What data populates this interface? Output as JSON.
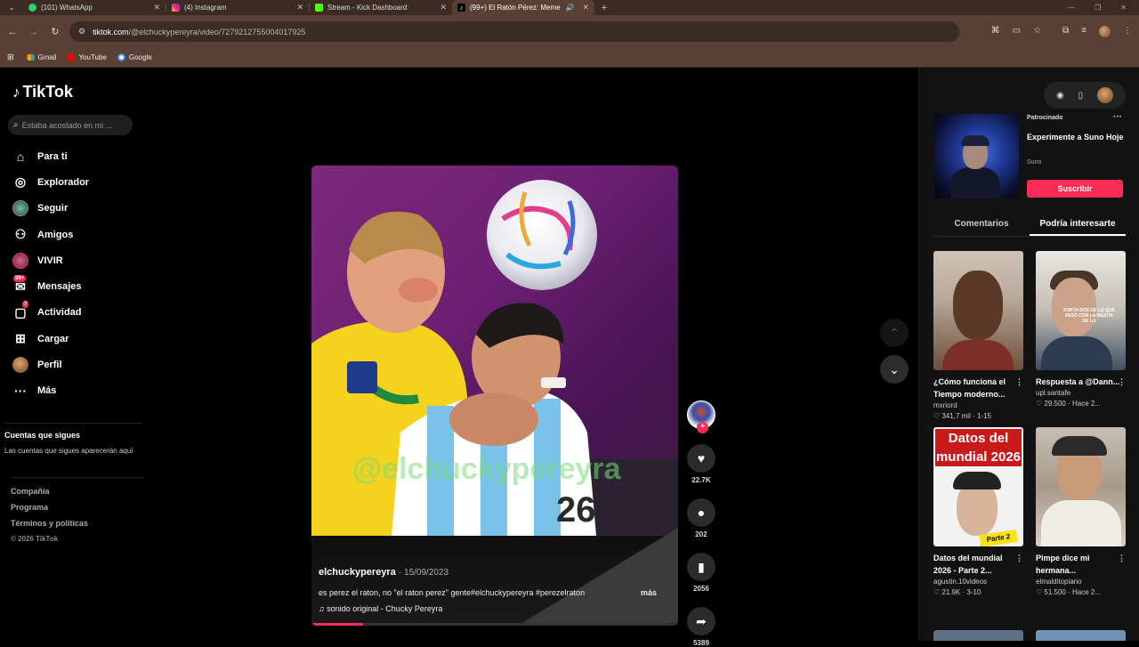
{
  "browser": {
    "tabs": [
      {
        "title": "(101) WhatsApp",
        "color": "#25d366"
      },
      {
        "title": "(4) Instagram",
        "color": "#e1306c"
      },
      {
        "title": "Stream - Kick Dashboard",
        "color": "#53fc18"
      },
      {
        "title": "(99+) El Ratón Pérez: Meme",
        "color": "#000000",
        "active": true
      }
    ],
    "url_host": "tiktok.com",
    "url_path": "/@elchuckypereyra/video/7279212755004017925",
    "bookmarks": [
      "Gmail",
      "YouTube",
      "Google"
    ]
  },
  "tiktok": {
    "logo": "TikTok",
    "search_placeholder": "Estaba acostado en mi ...",
    "nav": [
      {
        "label": "Para ti",
        "icon": "home-icon"
      },
      {
        "label": "Explorador",
        "icon": "compass-icon"
      },
      {
        "label": "Seguir",
        "icon": "following-icon"
      },
      {
        "label": "Amigos",
        "icon": "friends-icon"
      },
      {
        "label": "VIVIR",
        "icon": "live-icon"
      },
      {
        "label": "Mensajes",
        "icon": "messages-icon",
        "badge": "99+"
      },
      {
        "label": "Actividad",
        "icon": "activity-icon",
        "badge": "7"
      },
      {
        "label": "Cargar",
        "icon": "upload-icon"
      },
      {
        "label": "Perfil",
        "icon": "profile-icon"
      },
      {
        "label": "Más",
        "icon": "more-icon"
      }
    ],
    "following_header": "Cuentas que sigues",
    "following_empty": "Las cuentas que sigues aparecerán aquí",
    "footer": [
      "Compañía",
      "Programa",
      "Términos y políticas"
    ],
    "copyright": "© 2026 TikTok"
  },
  "video": {
    "watermark": "@elchuckypereyra",
    "author": "elchuckypereyra",
    "date": "· 15/09/2023",
    "description": "es perez el raton, no \"el raton perez\" gente#elchuckypereyra #perezelraton",
    "more": "más",
    "sound": "sonido original - Chucky Pereyra",
    "progress": 0.14,
    "likes": "22.7K",
    "comments": "202",
    "saves": "2056",
    "shares": "5389"
  },
  "right_panel": {
    "ad": {
      "label": "Patrocinado",
      "title": "Experimente a Suno Hoje",
      "brand": "Suno",
      "cta": "Suscribir"
    },
    "tabs": [
      "Comentarios",
      "Podría interesarte"
    ],
    "active_tab": "Podría interesarte",
    "cards": [
      {
        "title": "¿Cómo funciona el Tiempo moderno...",
        "author": "mxriord",
        "stats": "♡ 341,7 mil · 1-15"
      },
      {
        "title": "Respuesta a @Dann...",
        "author": "upl.santafe",
        "stats": "♡ 29.500 · Hace 2...",
        "thumb_text": "FORTA DOS DE LO QUE PASÓ CON LA MESITA DE LU"
      },
      {
        "title": "Datos del mundial 2026 - Parte 2...",
        "author": "agustin.10videos",
        "stats": "♡ 21.9K · 3-10",
        "banner": "Datos del mundial 2026",
        "tag": "Parte 2"
      },
      {
        "title": "Pimpe dice mi hermana...",
        "author": "elmalditopiano",
        "stats": "♡ 51.500 · Hace 2..."
      }
    ]
  }
}
